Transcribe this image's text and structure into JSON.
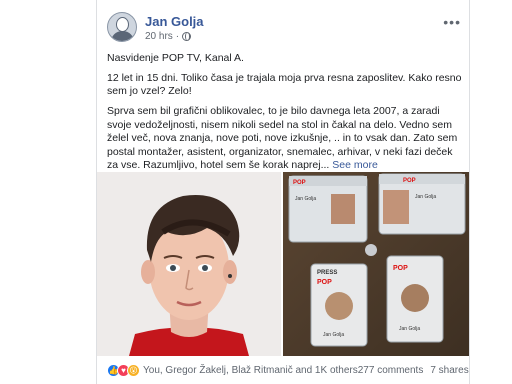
{
  "post": {
    "author": "Jan Golja",
    "time": "20 hrs",
    "privacy_icon": "globe-icon",
    "menu_icon": "more-options-icon",
    "text": {
      "line1": "Nasvidenje POP TV, Kanal A.",
      "para2": "12 let in 15 dni. Toliko časa je trajala moja prva resna zaposlitev. Kako resno sem jo vzel? Zelo!",
      "para3": "Sprva sem bil grafični oblikovalec, to je bilo davnega leta 2007, a zaradi svoje vedoželjnosti, nisem nikoli sedel na stol in čakal na delo. Vedno sem želel več, nova znanja, nove poti, nove izkušnje, .. in to vsak dan. Zato sem postal montažer, asistent, organizator, snemalec, arhivar, v neki fazi deček za vse. Razumljivo, hotel sem še korak naprej...",
      "see_more": "See more"
    },
    "photos": {
      "badge_press": "PRESS",
      "badge_brand": "POP",
      "badge_name": "Jan Golja"
    },
    "footer": {
      "reaction_icons": [
        "like-icon",
        "love-icon",
        "wow-icon"
      ],
      "reactors": "You, Gregor Žakelj, Blaž Ritmanič and 1K others",
      "comments": "277 comments",
      "shares": "7 shares"
    }
  },
  "colors": {
    "link": "#385898",
    "text": "#1c1e21",
    "muted": "#606770",
    "border": "#dddfe2"
  }
}
